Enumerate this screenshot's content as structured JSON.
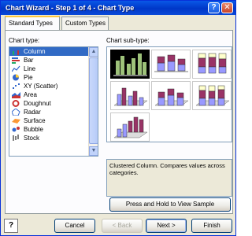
{
  "window": {
    "title": "Chart Wizard - Step 1 of 4 - Chart Type",
    "help_label": "?",
    "close_label": "✕"
  },
  "tabs": [
    {
      "label": "Standard Types",
      "active": true
    },
    {
      "label": "Custom Types",
      "active": false
    }
  ],
  "chart_type": {
    "label": "Chart type:",
    "items": [
      {
        "label": "Column",
        "icon": "column-chart-icon",
        "selected": true
      },
      {
        "label": "Bar",
        "icon": "bar-chart-icon"
      },
      {
        "label": "Line",
        "icon": "line-chart-icon"
      },
      {
        "label": "Pie",
        "icon": "pie-chart-icon"
      },
      {
        "label": "XY (Scatter)",
        "icon": "scatter-chart-icon"
      },
      {
        "label": "Area",
        "icon": "area-chart-icon"
      },
      {
        "label": "Doughnut",
        "icon": "doughnut-chart-icon"
      },
      {
        "label": "Radar",
        "icon": "radar-chart-icon"
      },
      {
        "label": "Surface",
        "icon": "surface-chart-icon"
      },
      {
        "label": "Bubble",
        "icon": "bubble-chart-icon"
      },
      {
        "label": "Stock",
        "icon": "stock-chart-icon"
      }
    ]
  },
  "subtype": {
    "label": "Chart sub-type:",
    "selected_index": 0,
    "description": "Clustered Column. Compares values across categories."
  },
  "press_hold_label": "Press and Hold to View Sample",
  "buttons": {
    "help": "?",
    "cancel": "Cancel",
    "back": "< Back",
    "next": "Next >",
    "finish": "Finish"
  },
  "colors": {
    "accent": "#0a58e6",
    "selection": "#316ac5",
    "bar_blue": "#9999ff",
    "bar_maroon": "#993366",
    "bar_cream": "#ffffcc",
    "bar_green_selected": "#9ec27a"
  }
}
